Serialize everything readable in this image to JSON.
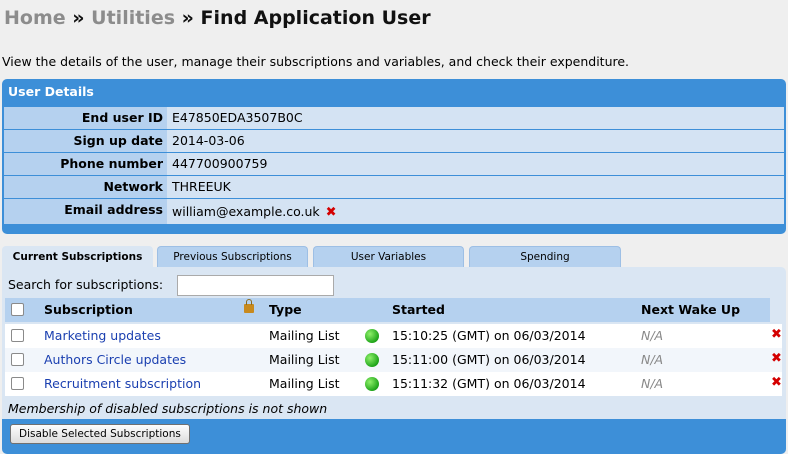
{
  "breadcrumb": {
    "home": "Home",
    "sep1": "»",
    "utilities": "Utilities",
    "sep2": "»",
    "current": "Find Application User"
  },
  "intro": "View the details of the user, manage their subscriptions and variables, and check their expenditure.",
  "user_details": {
    "title": "User Details",
    "rows": [
      {
        "label": "End user ID",
        "value": "E47850EDA3507B0C"
      },
      {
        "label": "Sign up date",
        "value": "2014-03-06"
      },
      {
        "label": "Phone number",
        "value": "447700900759"
      },
      {
        "label": "Network",
        "value": "THREEUK"
      },
      {
        "label": "Email address",
        "value": "william@example.co.uk"
      }
    ]
  },
  "tabs": [
    {
      "label": "Current Subscriptions",
      "active": true
    },
    {
      "label": "Previous Subscriptions",
      "active": false
    },
    {
      "label": "User Variables",
      "active": false
    },
    {
      "label": "Spending",
      "active": false
    }
  ],
  "subscriptions": {
    "search_label": "Search for subscriptions:",
    "search_value": "",
    "columns": {
      "subscription": "Subscription",
      "type": "Type",
      "started": "Started",
      "next_wake_up": "Next Wake Up"
    },
    "rows": [
      {
        "name": "Marketing updates",
        "type": "Mailing List",
        "started": "15:10:25 (GMT) on 06/03/2014",
        "next": "N/A"
      },
      {
        "name": "Authors Circle updates",
        "type": "Mailing List",
        "started": "15:11:00 (GMT) on 06/03/2014",
        "next": "N/A"
      },
      {
        "name": "Recruitment subscription",
        "type": "Mailing List",
        "started": "15:11:32 (GMT) on 06/03/2014",
        "next": "N/A"
      }
    ],
    "note": "Membership of disabled subscriptions is not shown",
    "disable_button": "Disable Selected Subscriptions"
  },
  "icons": {
    "remove": "x-icon",
    "status": "green-dot-icon",
    "lock": "lock-icon"
  },
  "colors": {
    "panel_blue": "#3d8fd8",
    "label_blue": "#b5d1ef",
    "remove_red": "#d40000",
    "status_green": "#1fa51a"
  }
}
